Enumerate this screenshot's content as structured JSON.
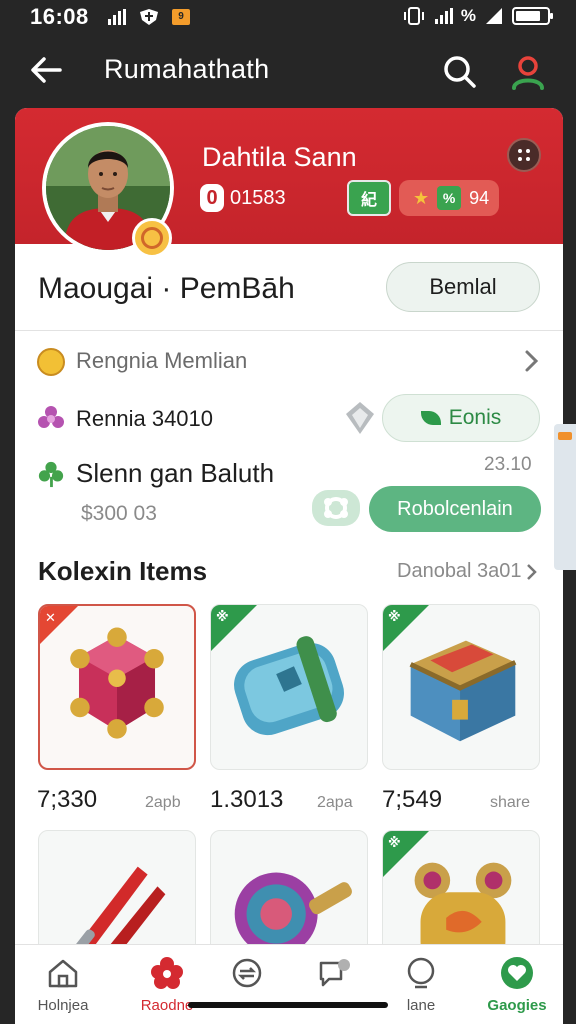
{
  "status_bar": {
    "time": "16:08",
    "right_text": "%",
    "notif_badge": "9"
  },
  "app_bar": {
    "title": "Rumahathath"
  },
  "profile": {
    "name": "Dahtila Sann",
    "level": "0",
    "id_number": "01583",
    "badge_green": "紀",
    "stat_value": "94",
    "stat_green": "%"
  },
  "section": {
    "title": "Maougai · PemBāh",
    "detail_button": "Bemlal"
  },
  "rows": {
    "row1_label": "Rengnia Memlian",
    "row2_label": "Rennia 34010",
    "bonus_label": "Eonis",
    "row3_label": "Slenn gan Baluth",
    "row3_value": "23.10",
    "row3_price": "$300 03",
    "cta_label": "Robolcenlain"
  },
  "collection": {
    "title": "Kolexin Items",
    "link": "Danobal 3a01",
    "items": [
      {
        "price": "7;330",
        "sub": "2apb",
        "corner": "red",
        "glyph": "✕",
        "art": "gem-cube"
      },
      {
        "price": "1.3013",
        "sub": "2apa",
        "corner": "green",
        "glyph": "※",
        "art": "blue-shield"
      },
      {
        "price": "7;549",
        "sub": "share",
        "corner": "green",
        "glyph": "※",
        "art": "treasure-chest"
      },
      {
        "price": "",
        "sub": "",
        "corner": "none",
        "glyph": "",
        "art": "red-sword"
      },
      {
        "price": "",
        "sub": "",
        "corner": "none",
        "glyph": "",
        "art": "magic-mirror"
      },
      {
        "price": "",
        "sub": "",
        "corner": "green",
        "glyph": "※",
        "art": "golden-relic"
      }
    ]
  },
  "bottom_nav": {
    "items": [
      {
        "label": "Holnjea",
        "icon": "home-icon",
        "color": "#555555"
      },
      {
        "label": "Raodne",
        "icon": "flower-icon",
        "color": "#d42a31"
      },
      {
        "label": "",
        "icon": "refresh-icon",
        "color": "#555555"
      },
      {
        "label": "",
        "icon": "chat-icon",
        "color": "#555555"
      },
      {
        "label": "lane",
        "icon": "search-icon",
        "color": "#555555"
      },
      {
        "label": "Gaogies",
        "icon": "heart-icon",
        "color": "#2e9a4b"
      }
    ]
  },
  "colors": {
    "brand_red": "#d42a31",
    "accent_green": "#2e9a4b"
  }
}
